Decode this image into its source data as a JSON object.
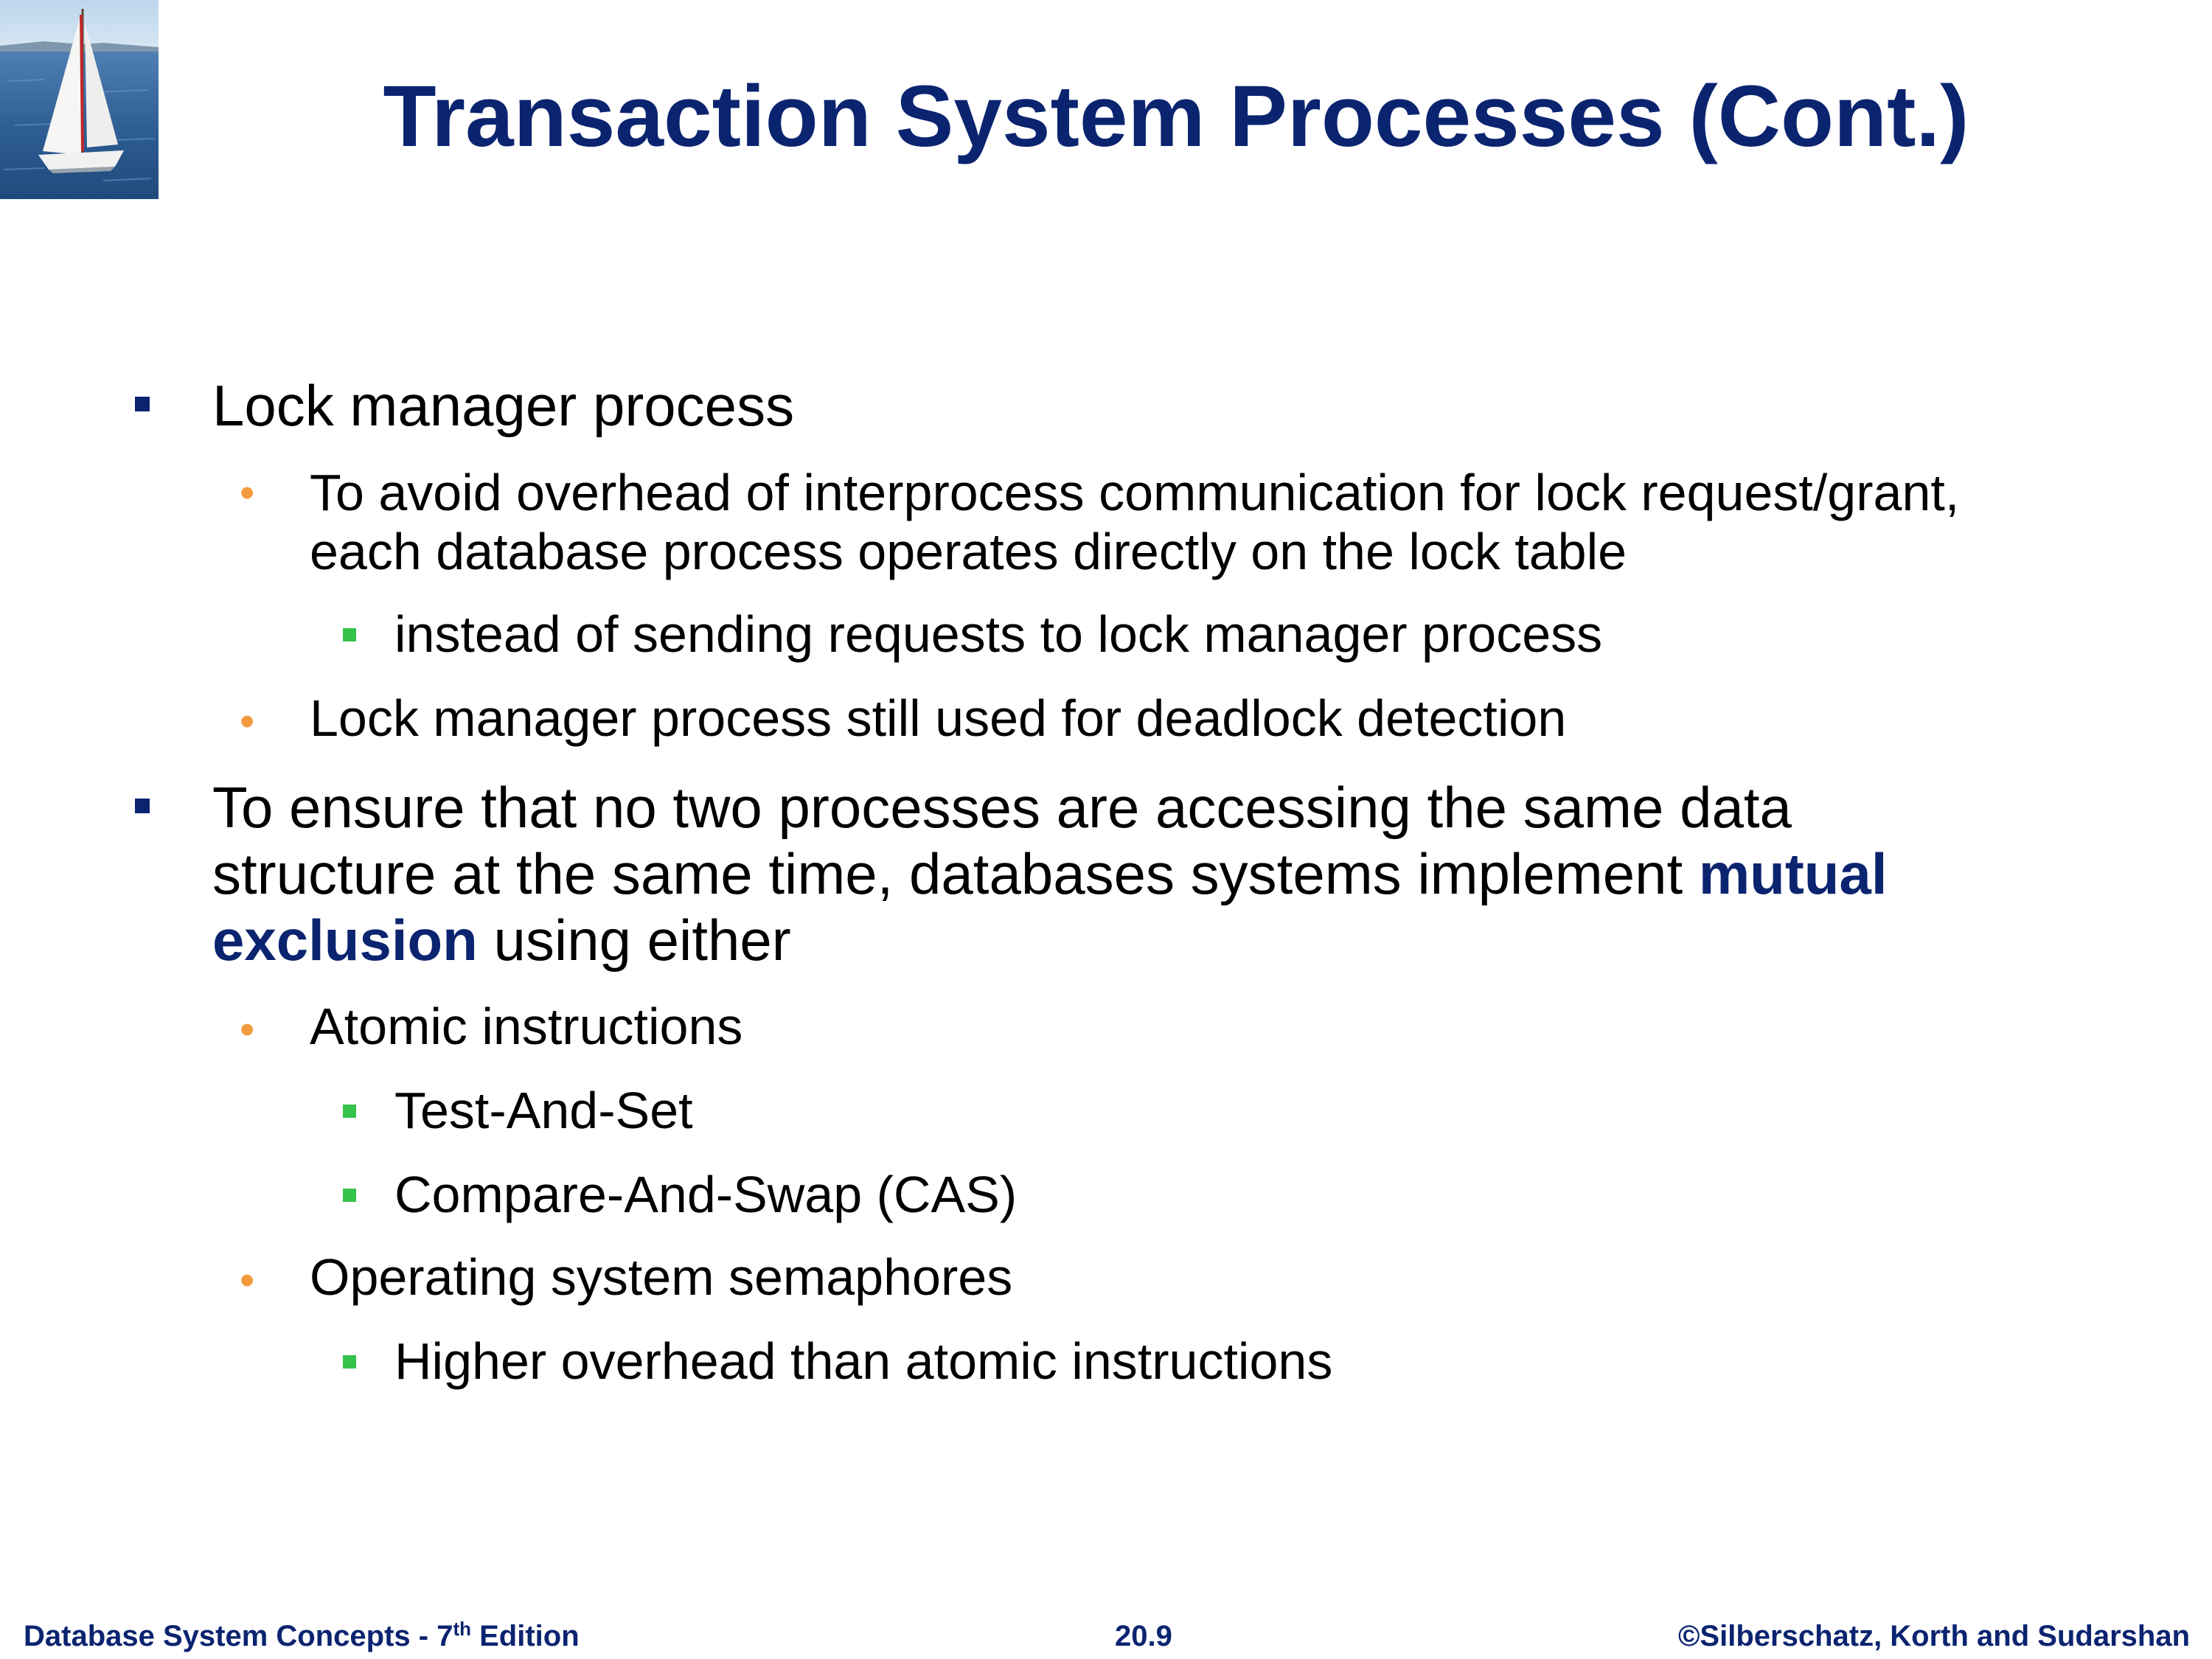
{
  "slide": {
    "title": "Transaction System Processes (Cont.)",
    "bullets": [
      {
        "text": "Lock manager process",
        "children": [
          {
            "line1": "To avoid overhead of interprocess communication for lock request/grant,",
            "line2": "each database process operates directly on the lock table",
            "children": [
              {
                "text": "instead of sending requests to lock manager process"
              }
            ]
          },
          {
            "text": "Lock manager process still used for deadlock detection"
          }
        ]
      },
      {
        "line1": "To ensure that no two processes are accessing the same data",
        "line2_pre": "structure at the same time, databases systems implement ",
        "line2_em": "mutual",
        "line3_em": "exclusion",
        "line3_post": " using either",
        "children": [
          {
            "text": "Atomic instructions",
            "children": [
              {
                "text": "Test-And-Set"
              },
              {
                "text": "Compare-And-Swap (CAS)"
              }
            ]
          },
          {
            "text": "Operating system semaphores",
            "children": [
              {
                "text": "Higher overhead than atomic instructions"
              }
            ]
          }
        ]
      }
    ]
  },
  "footer": {
    "book_prefix": "Database System Concepts - 7",
    "book_sup": "th",
    "book_suffix": " Edition",
    "page_number": "20.9",
    "copyright": "©Silberschatz, Korth and Sudarshan"
  },
  "logo": {
    "icon": "sailboat-logo"
  },
  "colors": {
    "title": "#0b2470",
    "level1_bullet": "#0b2470",
    "level2_bullet": "#f39a3e",
    "level3_bullet": "#34c24a",
    "emphasis": "#0b2470",
    "footer": "#0b2470"
  }
}
